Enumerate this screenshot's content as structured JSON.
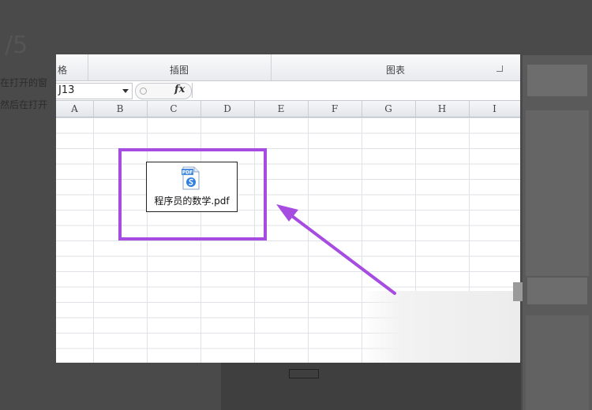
{
  "background": {
    "step_number": "/5",
    "line1": "在打开的窗",
    "line2": "然后在打开",
    "partial_ribbon_label": "格"
  },
  "ribbon": {
    "groups": [
      {
        "label": "插图"
      },
      {
        "label": "图表"
      }
    ]
  },
  "formula_bar": {
    "name_box_value": "J13",
    "fx_label": "fx",
    "formula_value": ""
  },
  "columns": [
    "A",
    "B",
    "C",
    "D",
    "E",
    "F",
    "G",
    "H",
    "I"
  ],
  "embedded_object": {
    "icon": "pdf-file-icon",
    "icon_badge": "PDF",
    "filename": "程序员的数学.pdf"
  },
  "colors": {
    "highlight": "#a64ce0",
    "page_background": "#4a4a4a",
    "pdf_badge": "#4a8de0"
  }
}
